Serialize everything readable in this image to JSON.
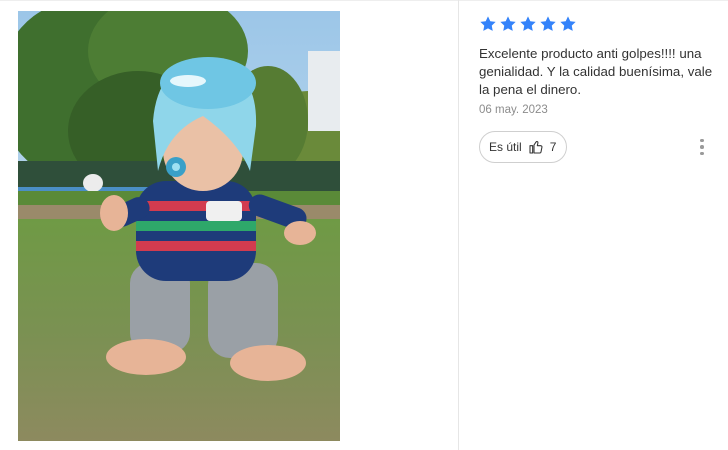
{
  "review": {
    "rating": 5,
    "star_color": "#3483fa",
    "icons": {
      "star": "star-icon",
      "helpful": "thumbs-up-icon",
      "more": "more-vertical-icon"
    },
    "text": "Excelente producto anti golpes!!!! una genialidad. Y la calidad buenísima, vale la pena el dinero.",
    "date": "06 may. 2023",
    "helpful_label": "Es útil",
    "helpful_count": "7"
  },
  "photo": {
    "subject": "baby-with-protective-helmet"
  }
}
